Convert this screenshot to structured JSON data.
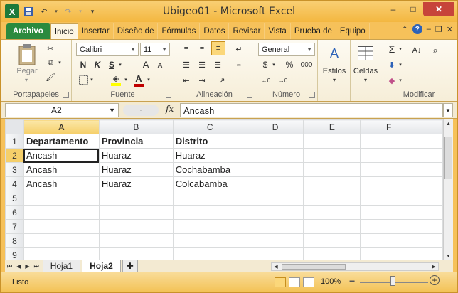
{
  "window": {
    "title": "Ubigeo01  -  Microsoft Excel",
    "logo_letter": "X",
    "controls": [
      "–",
      "□",
      "✕"
    ]
  },
  "ribbon_tabs": [
    "Archivo",
    "Inicio",
    "Insertar",
    "Diseño de",
    "Fórmulas",
    "Datos",
    "Revisar",
    "Vista",
    "Prueba de",
    "Equipo"
  ],
  "active_tab": "Inicio",
  "ribbon": {
    "clipboard": {
      "paste_label": "Pegar",
      "group_label": "Portapapeles"
    },
    "font": {
      "font_name": "Calibri",
      "font_size": "11",
      "bold": "N",
      "italic": "K",
      "underline": "S",
      "grow": "A",
      "shrink": "A",
      "group_label": "Fuente",
      "font_color": "#c00000",
      "fill_color": "#ffff00"
    },
    "alignment": {
      "group_label": "Alineación"
    },
    "number": {
      "format": "General",
      "currency": "$",
      "percent": "%",
      "thousands": "000",
      "group_label": "Número"
    },
    "styles": {
      "label": "Estilos"
    },
    "cells": {
      "label": "Celdas"
    },
    "editing": {
      "sum": "Σ",
      "group_label": "Modificar"
    }
  },
  "formula_bar": {
    "name_box": "A2",
    "fx": "fx",
    "value": "Ancash"
  },
  "sheet": {
    "columns": [
      "A",
      "B",
      "C",
      "D",
      "E",
      "F"
    ],
    "selected_column": "A",
    "selected_row": "2",
    "rows": [
      {
        "num": "1",
        "cells": [
          "Departamento",
          "Provincia",
          "Distrito",
          "",
          "",
          ""
        ]
      },
      {
        "num": "2",
        "cells": [
          "Ancash",
          "Huaraz",
          "Huaraz",
          "",
          "",
          ""
        ]
      },
      {
        "num": "3",
        "cells": [
          "Ancash",
          "Huaraz",
          "Cochabamba",
          "",
          "",
          ""
        ]
      },
      {
        "num": "4",
        "cells": [
          "Ancash",
          "Huaraz",
          "Colcabamba",
          "",
          "",
          ""
        ]
      },
      {
        "num": "5",
        "cells": [
          "",
          "",
          "",
          "",
          "",
          ""
        ]
      },
      {
        "num": "6",
        "cells": [
          "",
          "",
          "",
          "",
          "",
          ""
        ]
      },
      {
        "num": "7",
        "cells": [
          "",
          "",
          "",
          "",
          "",
          ""
        ]
      },
      {
        "num": "8",
        "cells": [
          "",
          "",
          "",
          "",
          "",
          ""
        ]
      },
      {
        "num": "9",
        "cells": [
          "",
          "",
          "",
          "",
          "",
          ""
        ]
      }
    ]
  },
  "sheet_tabs": [
    "Hoja1",
    "Hoja2"
  ],
  "active_sheet": "Hoja2",
  "status": {
    "ready": "Listo",
    "zoom": "100%",
    "zoom_minus": "−",
    "zoom_plus": "+"
  }
}
